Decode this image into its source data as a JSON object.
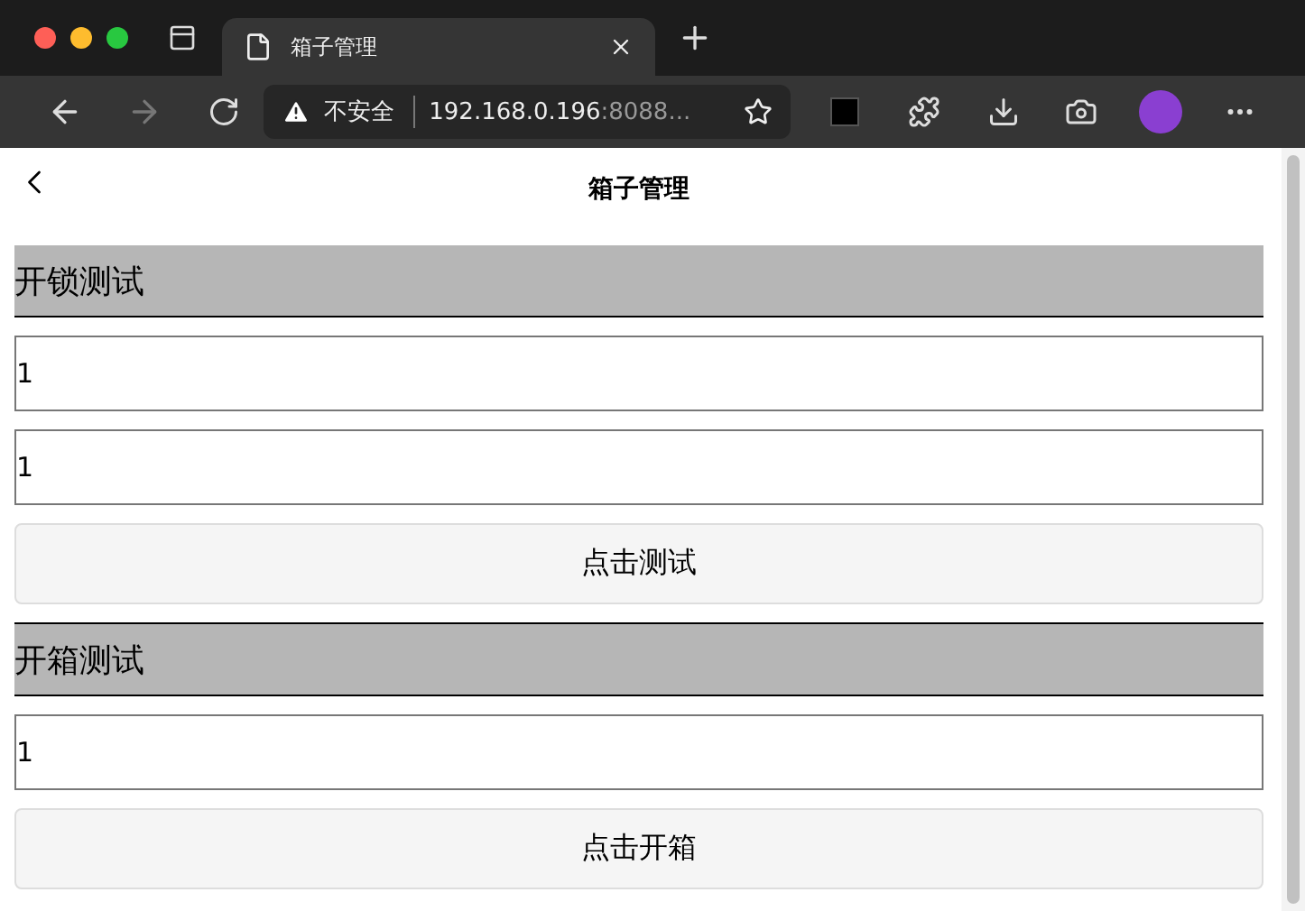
{
  "browser": {
    "tab_title": "箱子管理",
    "security": "不安全",
    "url_host": "192.168.0.196",
    "url_rest": ":8088..."
  },
  "page": {
    "title": "箱子管理"
  },
  "sections": [
    {
      "title": "开锁测试",
      "fields": [
        "1",
        "1"
      ],
      "button": "点击测试"
    },
    {
      "title": "开箱测试",
      "fields": [
        "1"
      ],
      "button": "点击开箱"
    }
  ]
}
